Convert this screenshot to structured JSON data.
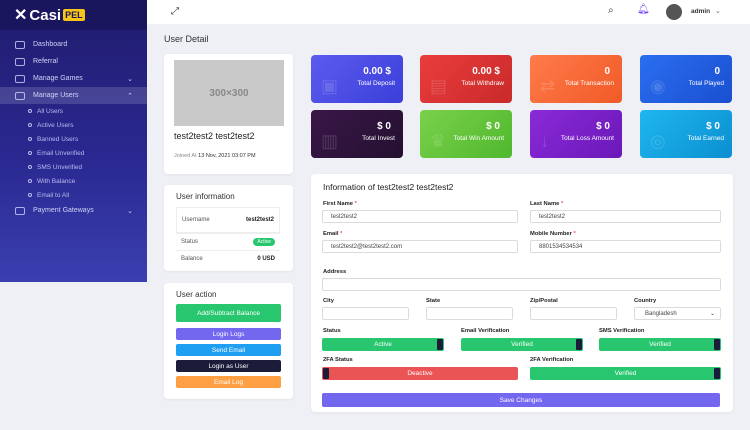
{
  "brand": {
    "x": "✕",
    "name": "Casi",
    "badge": "PEL"
  },
  "sidebar": {
    "items": [
      {
        "label": "Dashboard"
      },
      {
        "label": "Referral"
      },
      {
        "label": "Manage Games"
      },
      {
        "label": "Manage Users"
      }
    ],
    "subitems": [
      {
        "label": "All Users"
      },
      {
        "label": "Active Users"
      },
      {
        "label": "Banned Users"
      },
      {
        "label": "Email Unverified"
      },
      {
        "label": "SMS Unverified"
      },
      {
        "label": "With Balance"
      },
      {
        "label": "Email to All"
      }
    ],
    "payment": "Payment Gateways"
  },
  "topbar": {
    "user": "admin"
  },
  "page_title": "User Detail",
  "profile": {
    "image_text": "300×300",
    "name": "test2test2 test2test2",
    "joined_prefix": "Joined At",
    "joined_date": "13 Nov, 2021 03:07 PM"
  },
  "user_info": {
    "title": "User information",
    "username_label": "Username",
    "username": "test2test2",
    "status_label": "Status",
    "status": "Active",
    "balance_label": "Balance",
    "balance": "0 USD"
  },
  "user_action": {
    "title": "User action",
    "buttons": [
      {
        "label": "Add/Subtract Balance",
        "color": "#28c76f"
      },
      {
        "label": "Login Logs",
        "color": "#7367f0"
      },
      {
        "label": "Send Email",
        "color": "#1e9ff2"
      },
      {
        "label": "Login as User",
        "color": "#1b1b3a"
      },
      {
        "label": "Email Log",
        "color": "#ff9f43"
      }
    ]
  },
  "stats": [
    {
      "value": "0.00 $",
      "label": "Total Deposit",
      "bg": "linear-gradient(135deg,#5b5bf0,#3b3fd8)"
    },
    {
      "value": "0.00 $",
      "label": "Total Withdraw",
      "bg": "linear-gradient(135deg,#ea3c3c,#c92a2a)"
    },
    {
      "value": "0",
      "label": "Total Transaction",
      "bg": "linear-gradient(135deg,#ff7b4a,#f05a28)"
    },
    {
      "value": "0",
      "label": "Total Played",
      "bg": "linear-gradient(135deg,#2b6ef0,#1a4fd0)"
    },
    {
      "value": "$ 0",
      "label": "Total Invest",
      "bg": "linear-gradient(135deg,#3a1648,#241030)"
    },
    {
      "value": "$ 0",
      "label": "Total Win Amount",
      "bg": "linear-gradient(135deg,#7ad14a,#4fb82e)"
    },
    {
      "value": "$ 0",
      "label": "Total Loss Amount",
      "bg": "linear-gradient(135deg,#8a2ad8,#6a18b8)"
    },
    {
      "value": "$ 0",
      "label": "Total Earned",
      "bg": "linear-gradient(135deg,#1fb6ef,#0b8fd0)"
    }
  ],
  "form": {
    "title": "Information of test2test2 test2test2",
    "first_name_label": "First Name",
    "first_name": "test2test2",
    "last_name_label": "Last Name",
    "last_name": "test2test2",
    "email_label": "Email",
    "email": "test2test2@test2test2.com",
    "mobile_label": "Mobile Number",
    "mobile": "8801534534534",
    "address_label": "Address",
    "address": "",
    "city_label": "City",
    "state_label": "State",
    "zip_label": "Zip/Postal",
    "country_label": "Country",
    "country": "Bangladesh",
    "status_label": "Status",
    "status": "Active",
    "email_ver_label": "Email Verification",
    "email_ver": "Verified",
    "sms_ver_label": "SMS Verification",
    "sms_ver": "Verified",
    "twofa_status_label": "2FA Status",
    "twofa_status": "Deactive",
    "twofa_ver_label": "2FA Verification",
    "twofa_ver": "Verified",
    "save_label": "Save Changes"
  }
}
